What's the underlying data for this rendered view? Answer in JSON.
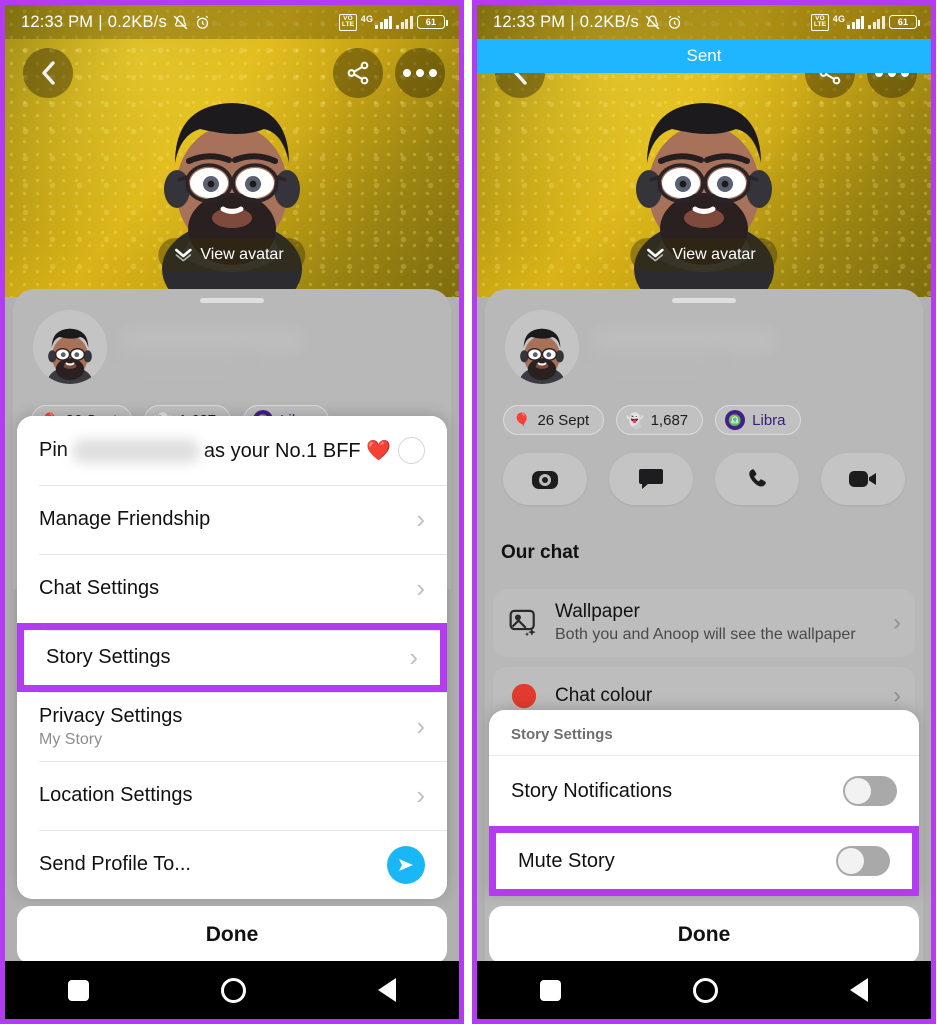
{
  "status_bar": {
    "time": "12:33 PM",
    "separator": "|",
    "network_speed": "0.2KB/s",
    "mute_icon": "bell-muted-icon",
    "alarm_icon": "alarm-clock-icon",
    "volte_label": "VO LTE",
    "network_type": "4G",
    "battery_level": "61"
  },
  "hero": {
    "back_icon": "chevron-left-icon",
    "share_icon": "share-icon",
    "more_icon": "more-options-icon",
    "view_avatar_label": "View avatar",
    "view_avatar_icon": "chevron-down-icon"
  },
  "banner": {
    "sent_label": "Sent"
  },
  "profile": {
    "avatar_name": "bitmoji-avatar",
    "name_blurred": true,
    "chips": [
      {
        "icon": "balloon-icon",
        "emoji": "🎈",
        "label": "26 Sept"
      },
      {
        "icon": "snapchat-ghost-icon",
        "emoji": "👻",
        "label": "1,687"
      },
      {
        "icon": "libra-zodiac-icon",
        "glyph": "♎",
        "label": "Libra"
      }
    ],
    "actions": [
      {
        "name": "camera-button",
        "icon": "camera-icon"
      },
      {
        "name": "chat-button",
        "icon": "chat-bubble-icon"
      },
      {
        "name": "call-button",
        "icon": "phone-icon"
      },
      {
        "name": "video-call-button",
        "icon": "video-camera-icon"
      }
    ]
  },
  "our_chat": {
    "section_title": "Our chat",
    "rows": [
      {
        "title": "Wallpaper",
        "subtitle": "Both you and Anoop will see the wallpaper",
        "icon": "image-sparkle-icon",
        "chevron": "›"
      },
      {
        "title": "Chat colour",
        "subtitle": "",
        "icon": "colour-swatch-icon",
        "chevron": "›"
      }
    ]
  },
  "left_menu": {
    "rows": [
      {
        "prefix": "Pin",
        "suffix": "as your No.1 BFF ❤️",
        "control": "radio-circle",
        "name": "pin-bff-row",
        "highlighted": false
      },
      {
        "label": "Manage Friendship",
        "control": "chevron",
        "name": "manage-friendship-row",
        "highlighted": false
      },
      {
        "label": "Chat Settings",
        "control": "chevron",
        "name": "chat-settings-row",
        "highlighted": false
      },
      {
        "label": "Story Settings",
        "control": "chevron",
        "name": "story-settings-row",
        "highlighted": true
      },
      {
        "label": "Privacy Settings",
        "sub": "My Story",
        "control": "chevron",
        "name": "privacy-settings-row",
        "highlighted": false
      },
      {
        "label": "Location Settings",
        "control": "chevron",
        "name": "location-settings-row",
        "highlighted": false
      },
      {
        "label": "Send Profile To...",
        "control": "send",
        "name": "send-profile-row",
        "highlighted": false
      }
    ],
    "done_label": "Done"
  },
  "story_settings_sheet": {
    "header": "Story Settings",
    "rows": [
      {
        "label": "Story Notifications",
        "toggle_on": false,
        "highlighted": false,
        "name": "story-notifications-row"
      },
      {
        "label": "Mute Story",
        "toggle_on": false,
        "highlighted": true,
        "name": "mute-story-row"
      }
    ],
    "done_label": "Done"
  },
  "nav_bar": {
    "recents_icon": "square-recents-icon",
    "home_icon": "circle-home-icon",
    "back_icon": "triangle-back-icon"
  },
  "colors": {
    "highlight_purple": "#b43cf0",
    "sent_blue": "#1fb6ff",
    "send_blue": "#19b7f5",
    "libra_purple": "#4a1b8c"
  }
}
